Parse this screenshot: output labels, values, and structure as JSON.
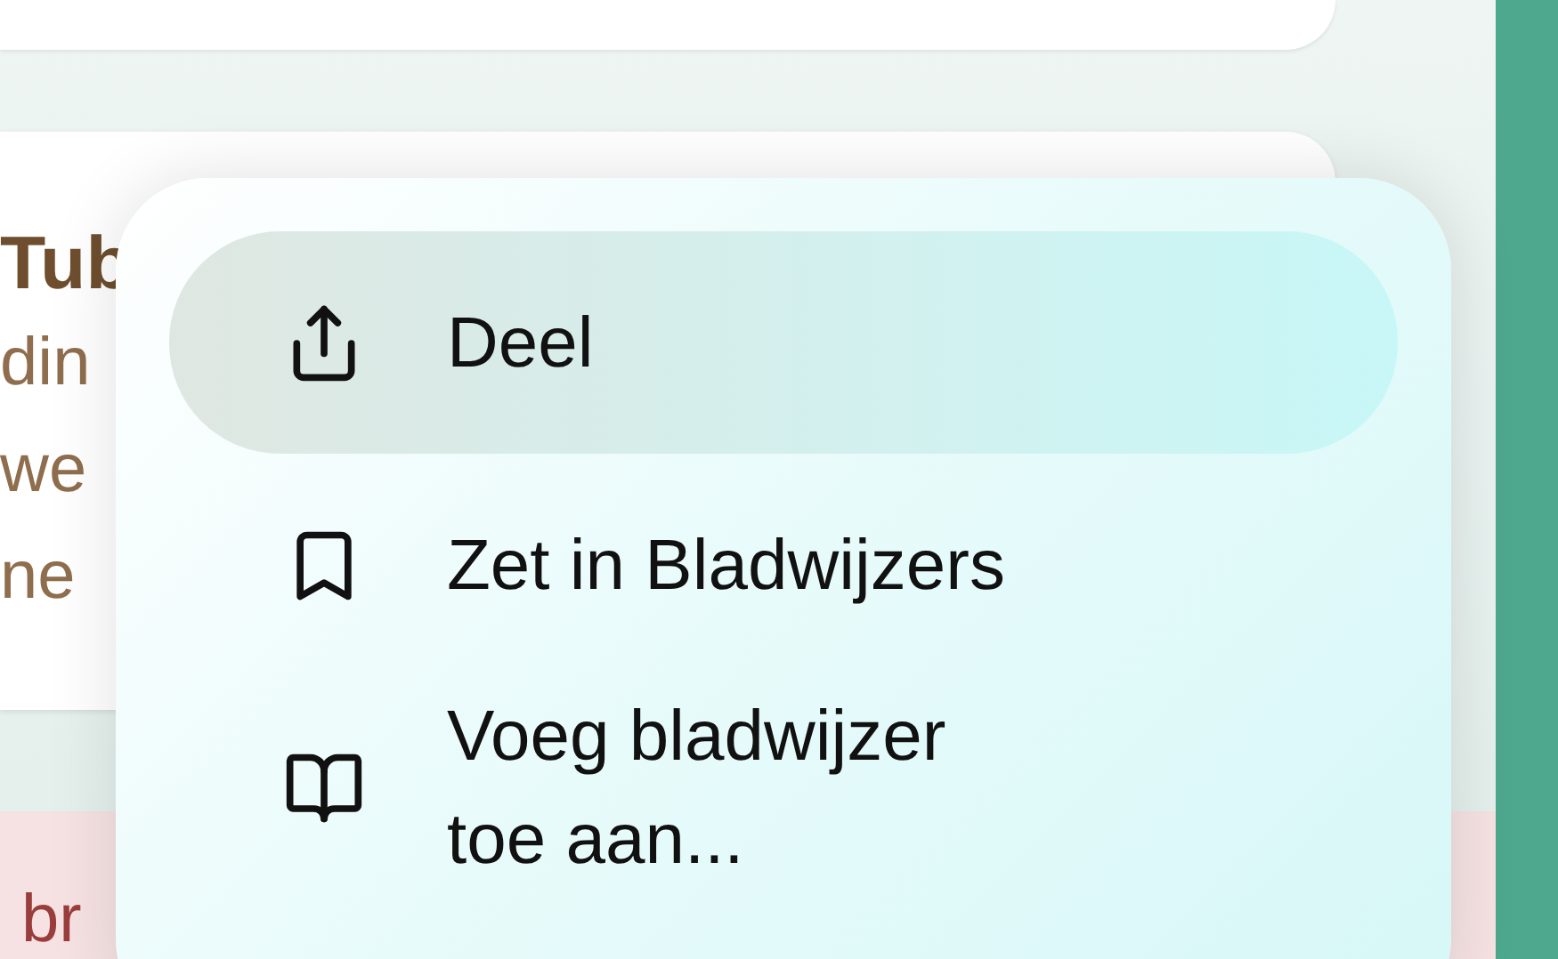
{
  "background": {
    "card_title": "Tub",
    "card_lines": [
      "din",
      "we",
      "ne"
    ],
    "alert_text": "br"
  },
  "menu": {
    "items": [
      {
        "label": "Deel",
        "selected": true
      },
      {
        "label": "Zet in Bladwijzers",
        "selected": false
      },
      {
        "label": "Voeg bladwijzer toe aan...",
        "selected": false
      }
    ]
  }
}
